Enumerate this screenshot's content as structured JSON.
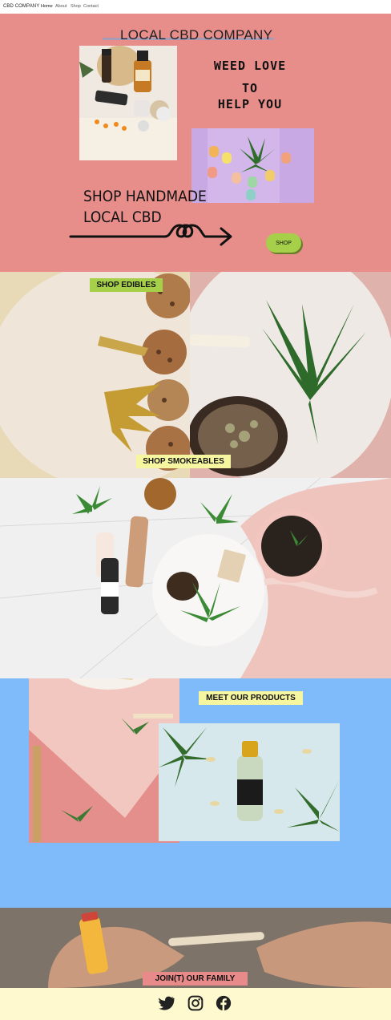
{
  "nav": {
    "brand": "CBD COMPANY",
    "links": [
      "Home",
      "About",
      "Shop",
      "Contact"
    ]
  },
  "hero": {
    "title": "LOCAL CBD COMPANY",
    "tagline_line1": "WEED LOVE",
    "tagline_line2": "TO",
    "tagline_line3": "HELP YOU",
    "shop_line1": "SHOP HANDMADE",
    "shop_line2": "LOCAL CBD",
    "shop_button": "SHOP"
  },
  "sections": {
    "edibles_label": "SHOP EDIBLES",
    "smokeables_label": "SHOP SMOKEABLES",
    "products_label": "MEET OUR PRODUCTS",
    "family_label": "JOIN(T) OUR FAMILY"
  },
  "social": {
    "icons": [
      "twitter-icon",
      "instagram-icon",
      "facebook-icon"
    ]
  },
  "colors": {
    "hero_bg": "#e78e8b",
    "accent_green": "#a6d04a",
    "products_bg": "#7fbafb",
    "footer_bg": "#fff9cf",
    "label_yellow": "#f6f6a0",
    "label_pink": "#e98a8a"
  }
}
